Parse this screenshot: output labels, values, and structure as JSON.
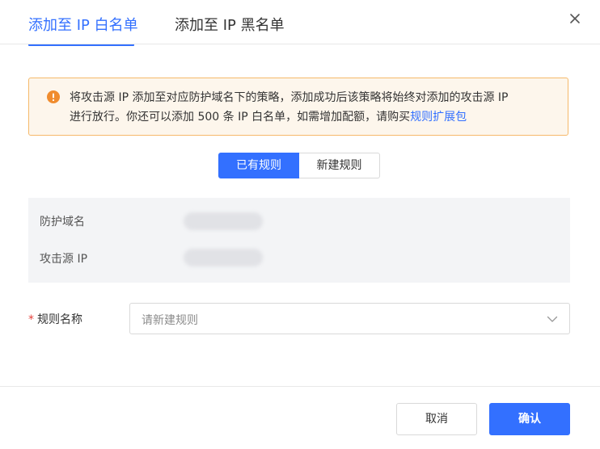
{
  "tabs": {
    "whitelist": "添加至 IP 白名单",
    "blacklist": "添加至 IP 黑名单"
  },
  "alert": {
    "line1": "将攻击源 IP 添加至对应防护域名下的策略，添加成功后该策略将始终对添加的攻击源 IP",
    "line2_prefix": "进行放行。你还可以添加 500 条 IP 白名单，如需增加配额，请购买",
    "link": "规则扩展包"
  },
  "segment": {
    "existing": "已有规则",
    "new": "新建规则"
  },
  "info": {
    "domain_label": "防护域名",
    "ip_label": "攻击源 IP"
  },
  "form": {
    "required_mark": "*",
    "rule_name_label": "规则名称",
    "rule_name_placeholder": "请新建规则"
  },
  "footer": {
    "cancel": "取消",
    "confirm": "确认"
  },
  "icons": {
    "close": "close-icon",
    "warning": "warning-circle-icon",
    "chevron": "chevron-down-icon"
  },
  "colors": {
    "primary": "#3370ff",
    "warning": "#f08c2e",
    "alert_bg": "#fdf6ec",
    "alert_border": "#f6b96a",
    "required": "#e5413b"
  }
}
